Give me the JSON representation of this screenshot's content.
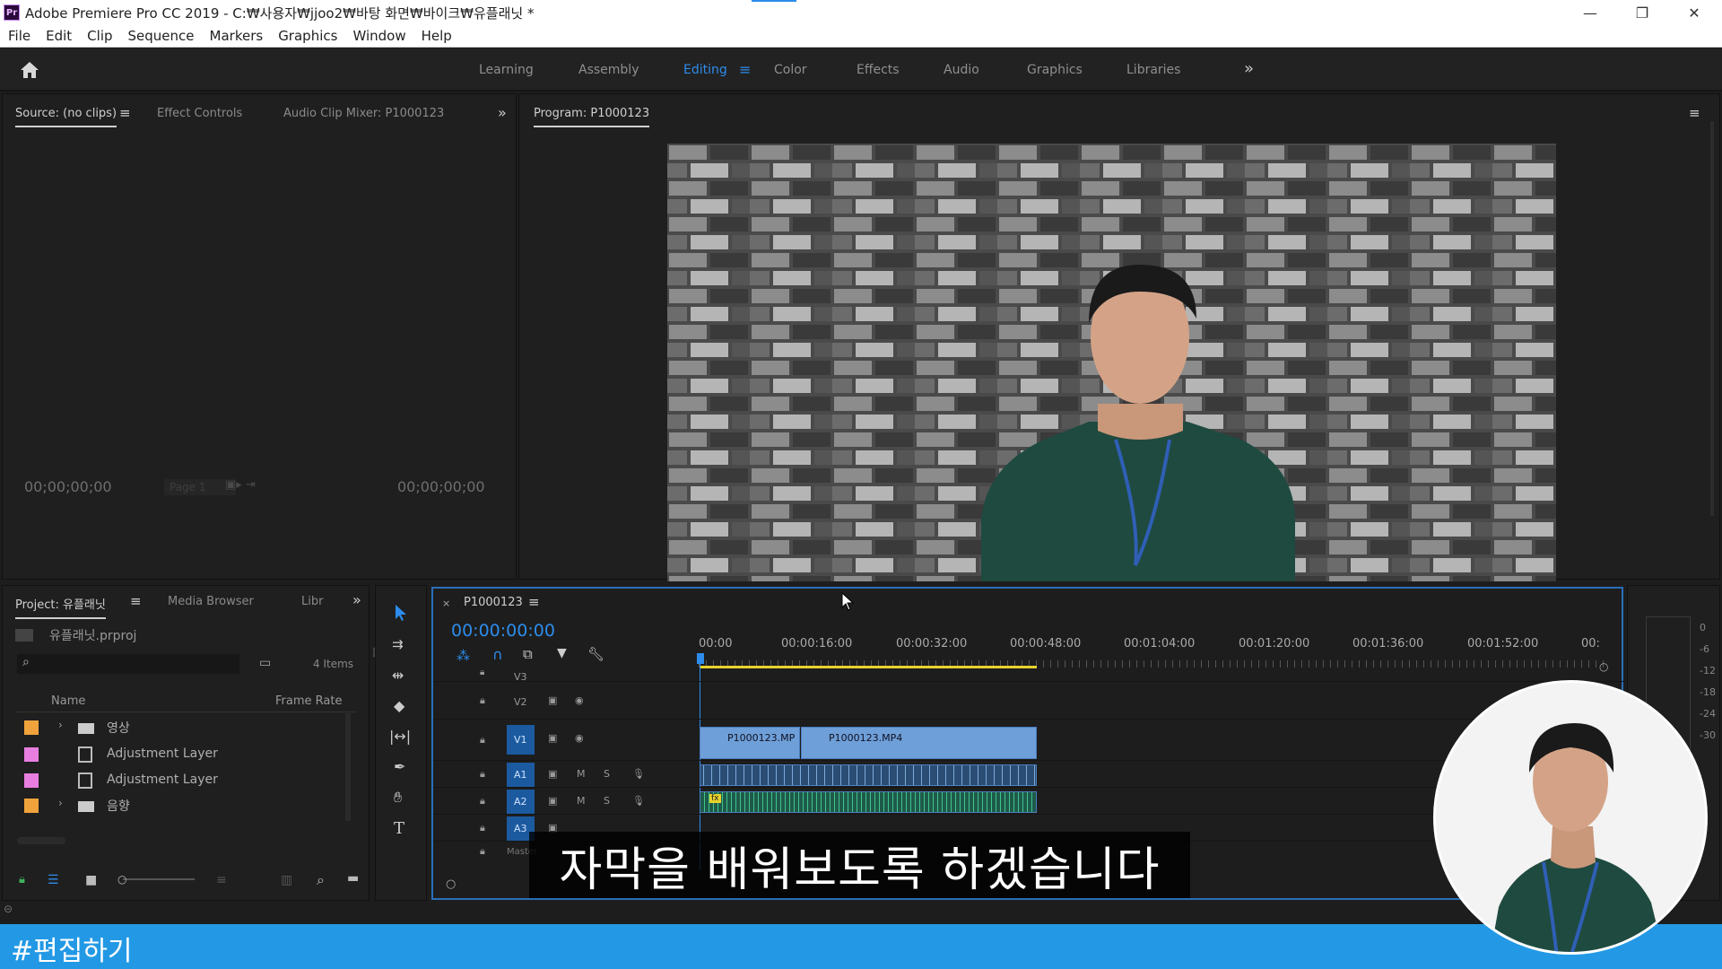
{
  "window": {
    "app_icon": "Pr",
    "title": "Adobe Premiere Pro CC 2019 - C:₩사용자₩jjoo2₩바탕 화면₩바이크₩유플래닛 *",
    "minimize": "—",
    "restore": "❐",
    "close": "✕"
  },
  "menu": [
    "File",
    "Edit",
    "Clip",
    "Sequence",
    "Markers",
    "Graphics",
    "Window",
    "Help"
  ],
  "workspaces": {
    "items": [
      "Learning",
      "Assembly",
      "Editing",
      "Color",
      "Effects",
      "Audio",
      "Graphics",
      "Libraries"
    ],
    "active": "Editing",
    "overflow": "»"
  },
  "source_panel": {
    "tabs": [
      "Source: (no clips)",
      "Effect Controls",
      "Audio Clip Mixer: P1000123"
    ],
    "timecode_left": "00;00;00;00",
    "timecode_right": "00;00;00;00",
    "page_label": "Page 1"
  },
  "program_panel": {
    "title": "Program: P1000123"
  },
  "project_panel": {
    "tabs": [
      "Project: 유플래닛",
      "Media Browser",
      "Libr"
    ],
    "project_file": "유플래닛.prproj",
    "item_count": "4 Items",
    "columns": [
      "Name",
      "Frame Rate"
    ],
    "items": [
      {
        "name": "영상",
        "type": "folder",
        "color": "#f0a33c"
      },
      {
        "name": "Adjustment Layer",
        "type": "adjustment",
        "color": "#e87fe0"
      },
      {
        "name": "Adjustment Layer",
        "type": "adjustment",
        "color": "#e87fe0"
      },
      {
        "name": "음향",
        "type": "folder",
        "color": "#f0a33c"
      }
    ]
  },
  "tools": [
    "selection-tool",
    "track-select-tool",
    "ripple-edit-tool",
    "razor-tool",
    "slip-tool",
    "pen-tool",
    "hand-tool",
    "type-tool"
  ],
  "timeline": {
    "sequence": "P1000123",
    "timecode": "00:00:00:00",
    "ruler": [
      "00:00",
      "00:00:16:00",
      "00:00:32:00",
      "00:00:48:00",
      "00:01:04:00",
      "00:01:20:00",
      "00:01:36:00",
      "00:01:52:00",
      "00:"
    ],
    "tracks": [
      "V3",
      "V2",
      "V1",
      "A1",
      "A2",
      "A3",
      "Master"
    ],
    "clips": [
      "P1000123.MP",
      "P1000123.MP4"
    ],
    "meter_scale": [
      "0",
      "-6",
      "-12",
      "-18",
      "-24",
      "-30"
    ],
    "track_buttons": {
      "mute": "M",
      "solo": "S",
      "fx": "fx"
    }
  },
  "subtitle": "자막을 배워보도록 하겠습니다",
  "hashtag": "#편집하기",
  "colors": {
    "accent": "#2d8ceb",
    "timeline_border": "#2a6fb8",
    "clip_video": "#6e9fd8",
    "hashtag_bar": "#2399e5"
  }
}
